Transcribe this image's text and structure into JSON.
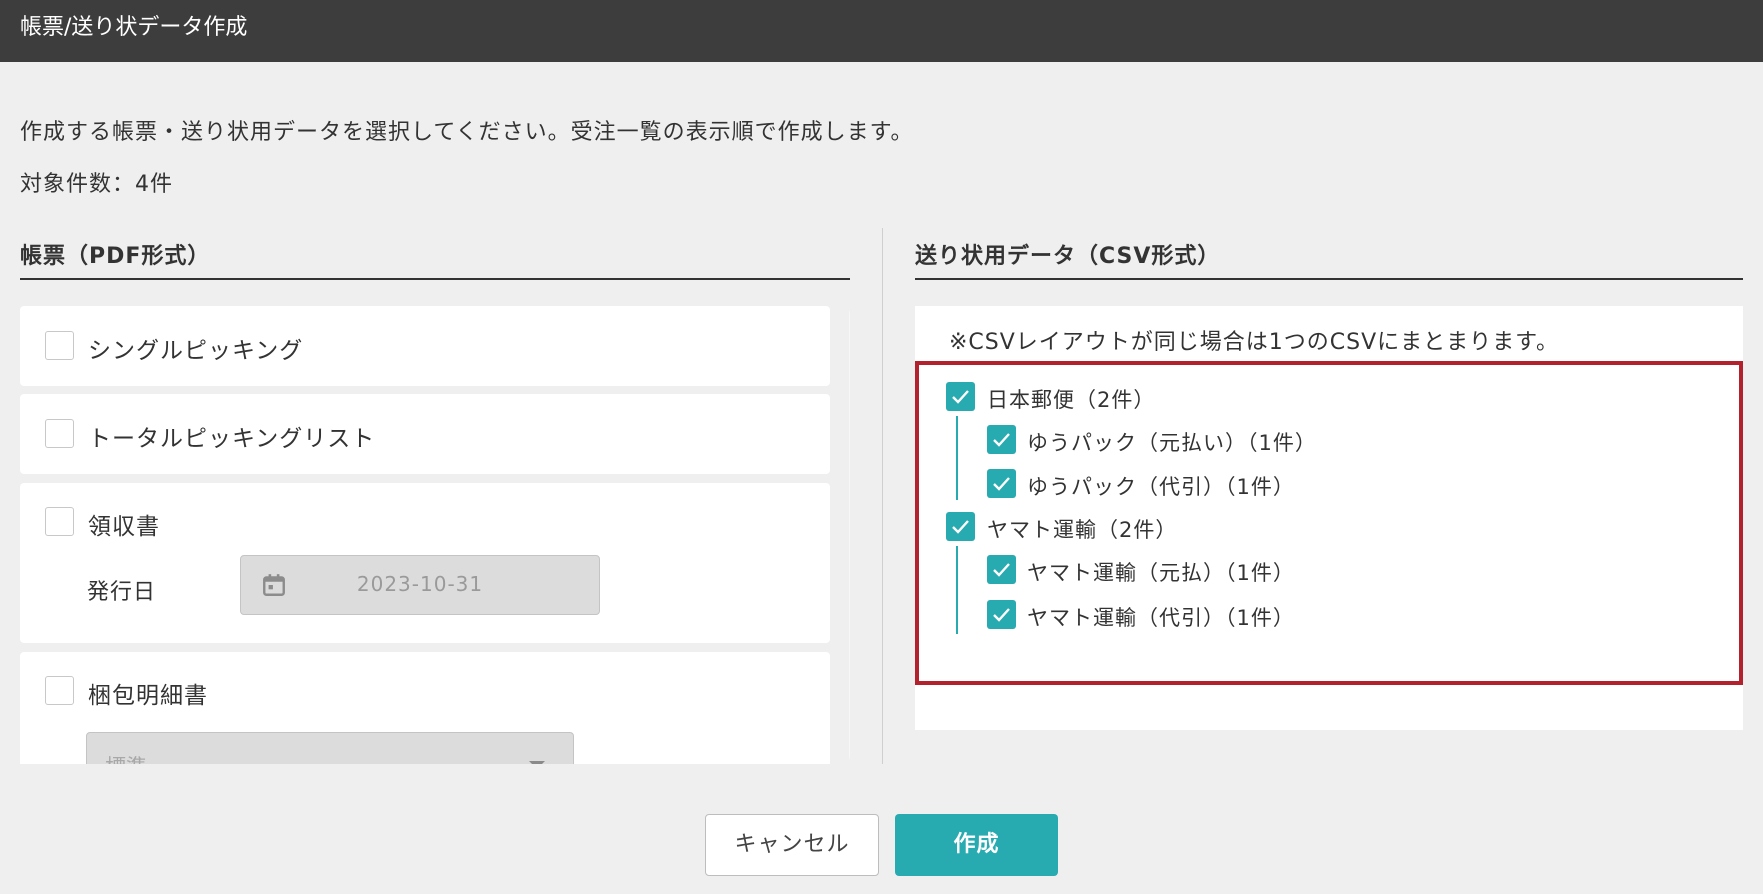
{
  "window": {
    "title": "帳票/送り状データ作成"
  },
  "intro": {
    "description": "作成する帳票・送り状用データを選択してください。受注一覧の表示順で作成します。",
    "count_text": "対象件数：4件"
  },
  "pdf_section": {
    "title": "帳票（PDF形式）",
    "items": [
      {
        "label": "シングルピッキング",
        "checked": false
      },
      {
        "label": "トータルピッキングリスト",
        "checked": false
      },
      {
        "label": "領収書",
        "checked": false,
        "date_label": "発行日",
        "date_value": "2023-10-31"
      },
      {
        "label": "梱包明細書",
        "checked": false,
        "select_value": "標準"
      }
    ]
  },
  "csv_section": {
    "title": "送り状用データ（CSV形式）",
    "note": "※CSVレイアウトが同じ場合は1つのCSVにまとまります。",
    "groups": [
      {
        "label": "日本郵便（2件）",
        "checked": true,
        "children": [
          {
            "label": "ゆうパック（元払い）（1件）",
            "checked": true
          },
          {
            "label": "ゆうパック（代引）（1件）",
            "checked": true
          }
        ]
      },
      {
        "label": "ヤマト運輸（2件）",
        "checked": true,
        "children": [
          {
            "label": "ヤマト運輸（元払）（1件）",
            "checked": true
          },
          {
            "label": "ヤマト運輸（代引）（1件）",
            "checked": true
          }
        ]
      }
    ]
  },
  "buttons": {
    "cancel": "キャンセル",
    "create": "作成"
  },
  "colors": {
    "accent": "#27aab0",
    "titlebar": "#3d3d3d",
    "highlight": "#b3222c",
    "background": "#efefef"
  },
  "icons": {
    "date": "calendar-icon",
    "checked": "check-icon",
    "dropdown": "chevron-down-icon"
  }
}
